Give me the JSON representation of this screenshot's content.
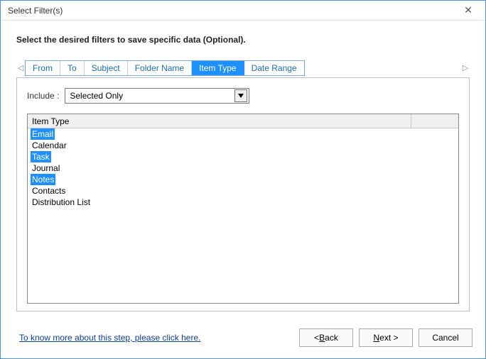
{
  "window": {
    "title": "Select Filter(s)",
    "close_glyph": "✕"
  },
  "instruction": "Select the desired filters to save specific data (Optional).",
  "tabs": {
    "nav_left": "◁",
    "nav_right": "▷",
    "items": [
      {
        "label": "From",
        "active": false
      },
      {
        "label": "To",
        "active": false
      },
      {
        "label": "Subject",
        "active": false
      },
      {
        "label": "Folder Name",
        "active": false
      },
      {
        "label": "Item Type",
        "active": true
      },
      {
        "label": "Date Range",
        "active": false
      }
    ]
  },
  "include": {
    "label": "Include :",
    "value": "Selected Only"
  },
  "list": {
    "header": "Item Type",
    "items": [
      {
        "label": "Email",
        "selected": true
      },
      {
        "label": "Calendar",
        "selected": false
      },
      {
        "label": "Task",
        "selected": true
      },
      {
        "label": "Journal",
        "selected": false
      },
      {
        "label": "Notes",
        "selected": true
      },
      {
        "label": "Contacts",
        "selected": false
      },
      {
        "label": "Distribution List",
        "selected": false
      }
    ]
  },
  "footer": {
    "help_link": "To know more about this step, please click here.",
    "back_prefix": "< ",
    "back_u": "B",
    "back_rest": "ack",
    "next_u": "N",
    "next_rest": "ext >",
    "cancel": "Cancel"
  }
}
